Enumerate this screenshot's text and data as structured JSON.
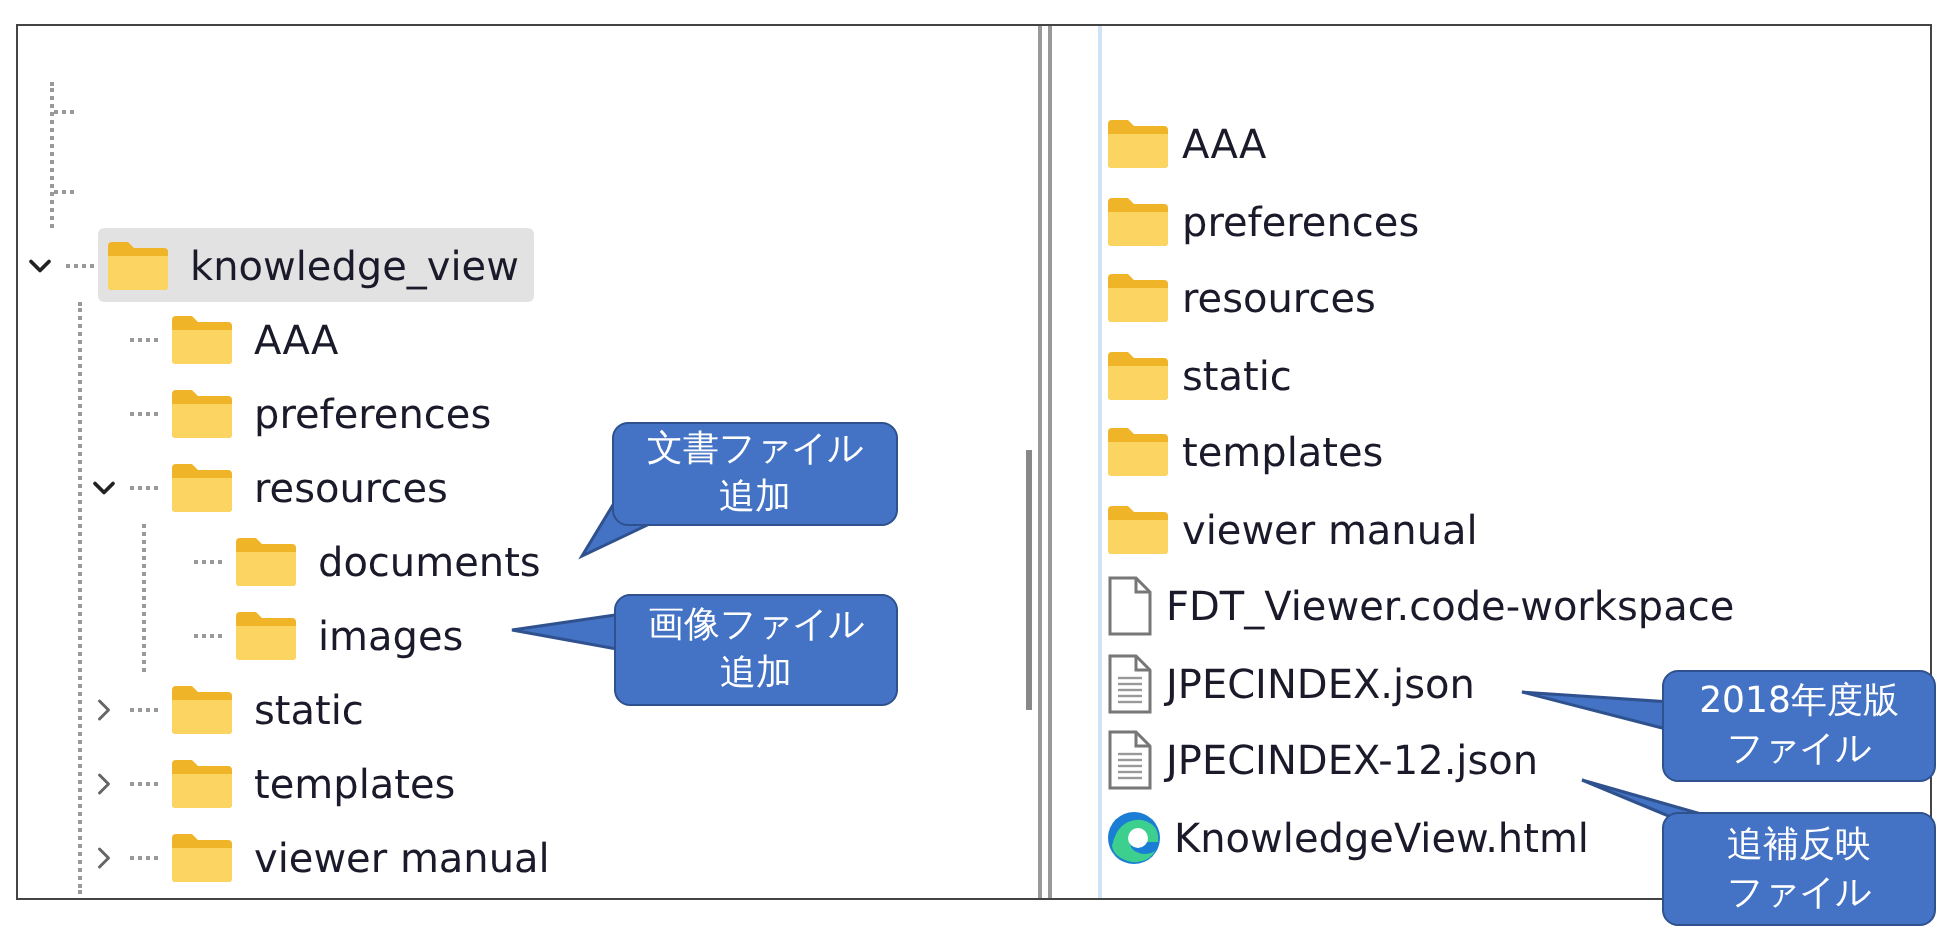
{
  "tree": [
    {
      "label": "knowledge_view",
      "selected": true,
      "expanded": true,
      "children": [
        {
          "label": "AAA",
          "selected": false
        },
        {
          "label": "preferences",
          "selected": false
        },
        {
          "label": "resources",
          "selected": false,
          "expanded": true,
          "children": [
            {
              "label": "documents",
              "selected": false
            },
            {
              "label": "images",
              "selected": false
            }
          ]
        },
        {
          "label": "static",
          "selected": false,
          "expanded": false
        },
        {
          "label": "templates",
          "selected": false,
          "expanded": false
        },
        {
          "label": "viewer manual",
          "selected": false,
          "expanded": false
        }
      ]
    }
  ],
  "file_list": [
    {
      "name": "AAA",
      "kind": "folder"
    },
    {
      "name": "preferences",
      "kind": "folder"
    },
    {
      "name": "resources",
      "kind": "folder"
    },
    {
      "name": "static",
      "kind": "folder"
    },
    {
      "name": "templates",
      "kind": "folder"
    },
    {
      "name": "viewer manual",
      "kind": "folder"
    },
    {
      "name": "FDT_Viewer.code-workspace",
      "kind": "file"
    },
    {
      "name": "JPECINDEX.json",
      "kind": "text"
    },
    {
      "name": "JPECINDEX-12.json",
      "kind": "text"
    },
    {
      "name": "KnowledgeView.html",
      "kind": "browser"
    }
  ],
  "callouts": [
    {
      "lines": [
        "文書ファイル",
        "追加"
      ]
    },
    {
      "lines": [
        "画像ファイル",
        "追加"
      ]
    },
    {
      "lines": [
        "2018年度版",
        "ファイル"
      ]
    },
    {
      "lines": [
        "追補反映",
        "ファイル"
      ]
    }
  ]
}
